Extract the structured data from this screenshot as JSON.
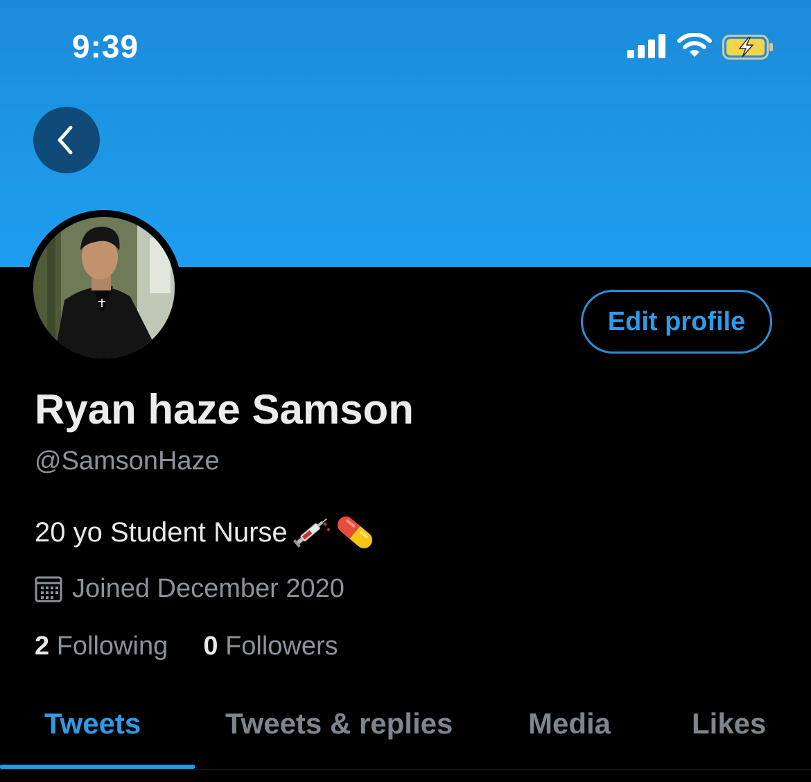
{
  "status_bar": {
    "time": "9:39",
    "icons": [
      "cellular-signal-icon",
      "wifi-icon",
      "battery-charging-icon"
    ],
    "battery_color": "#f5d547"
  },
  "header": {
    "banner_color": "#1d9bf0",
    "back_icon": "chevron-left-icon"
  },
  "profile": {
    "display_name": "Ryan haze Samson",
    "handle": "@SamsonHaze",
    "bio": "20 yo Student Nurse",
    "bio_emoji": [
      "syringe-emoji",
      "pill-emoji"
    ],
    "joined": "Joined December 2020",
    "edit_button_label": "Edit profile",
    "following_count": "2",
    "following_label": "Following",
    "followers_count": "0",
    "followers_label": "Followers"
  },
  "tabs": [
    {
      "label": "Tweets",
      "active": true
    },
    {
      "label": "Tweets & replies",
      "active": false
    },
    {
      "label": "Media",
      "active": false
    },
    {
      "label": "Likes",
      "active": false
    }
  ],
  "colors": {
    "accent": "#1d9bf0",
    "background": "#000000",
    "secondary_text": "#8b939b"
  }
}
